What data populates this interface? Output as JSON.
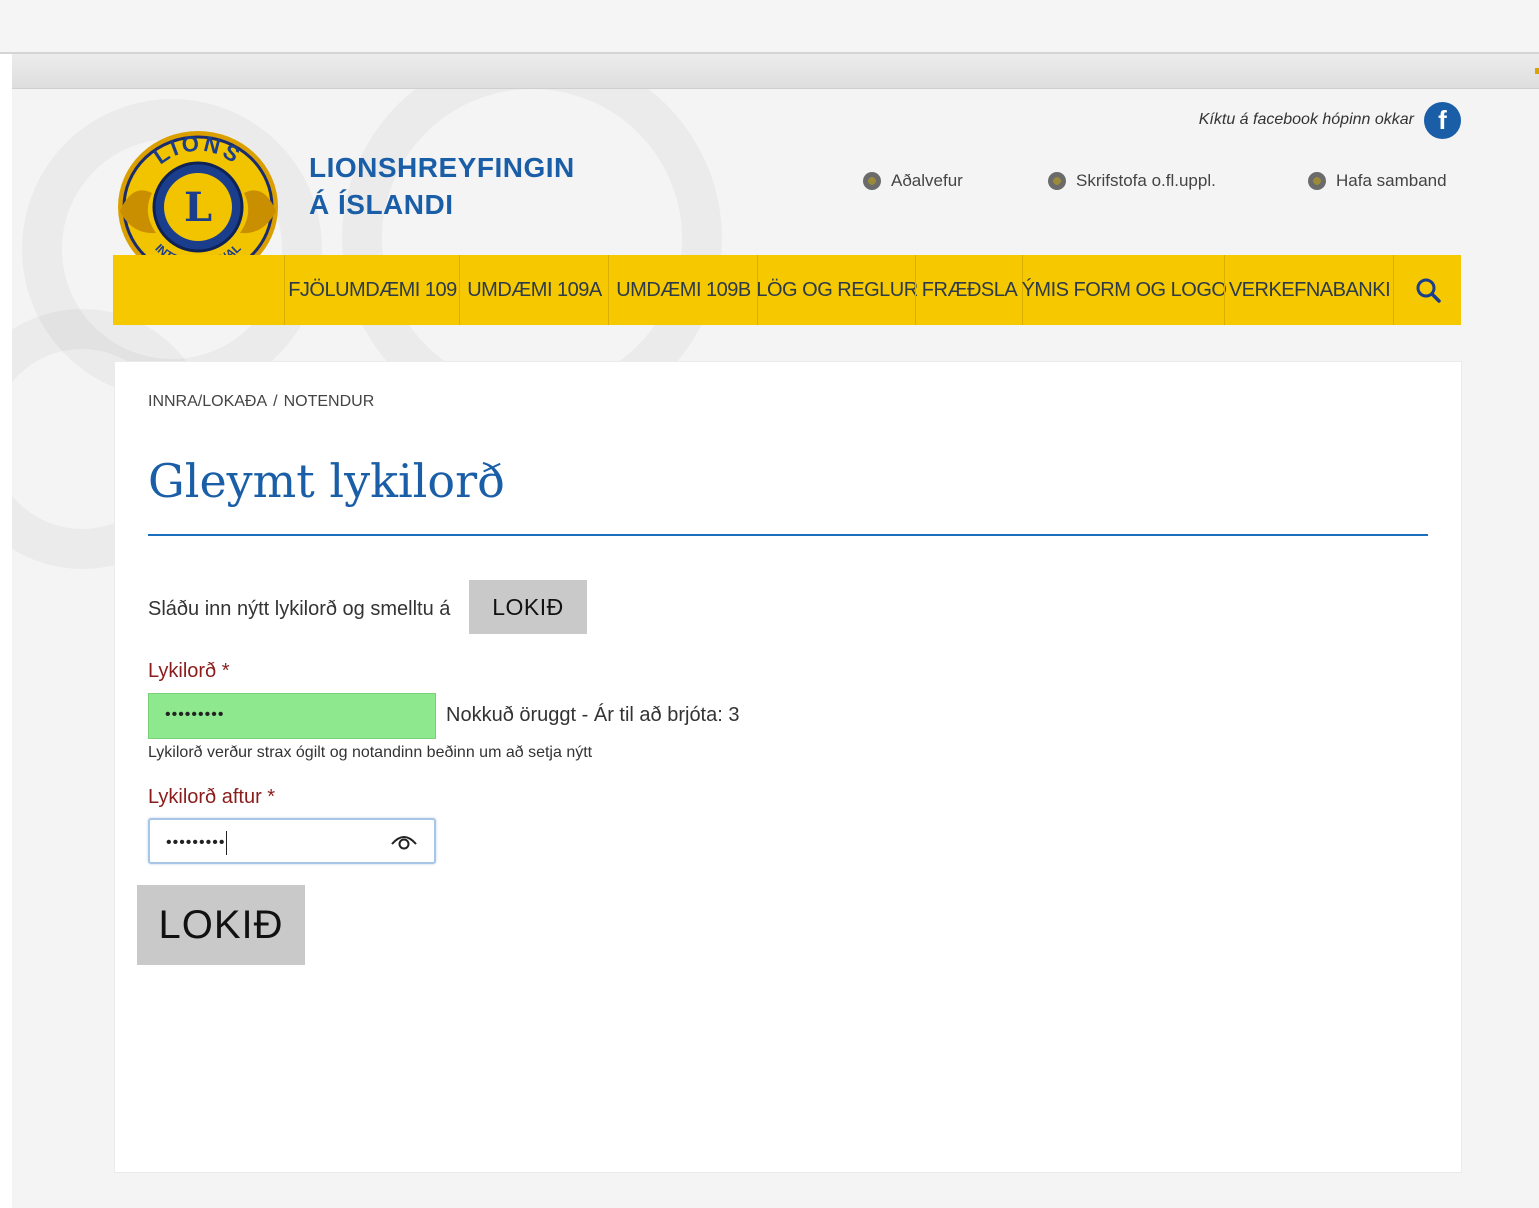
{
  "header": {
    "brand_line1": "LIONSHREYFINGIN",
    "brand_line2": "Á ÍSLANDI",
    "facebook_text": "Kíktu á facebook hópinn okkar",
    "logo_text_top": "LIONS",
    "logo_text_bottom": "INTERNATIONAL",
    "logo_letter": "L",
    "top_links": [
      "Aðalvefur",
      "Skrifstofa o.fl.uppl.",
      "Hafa samband"
    ]
  },
  "nav": {
    "items": [
      "FJÖLUMDÆMI 109",
      "UMDÆMI 109A",
      "UMDÆMI 109B",
      "LÖG OG REGLUR",
      "FRÆÐSLA",
      "ÝMIS FORM OG LOGO",
      "VERKEFNABANKI"
    ]
  },
  "breadcrumb": {
    "items": [
      "INNRA/LOKAÐA",
      "NOTENDUR"
    ],
    "separator": "/"
  },
  "page_title": "Gleymt lykilorð",
  "form": {
    "instruction": "Sláðu inn nýtt lykilorð og smelltu á",
    "inline_button": "LOKIÐ",
    "password_label": "Lykilorð *",
    "password_value": "•••••••••",
    "strength_text": "Nokkuð öruggt - Ár til að brjóta: 3",
    "help_text": "Lykilorð verður strax ógilt og notandinn beðinn um að setja nýtt",
    "confirm_label": "Lykilorð aftur *",
    "confirm_value": "•••••••••",
    "submit_button": "LOKIÐ"
  },
  "colors": {
    "brand_blue": "#1a5ea8",
    "nav_yellow": "#f5c800",
    "strength_green": "#8ee88e",
    "label_red": "#8b1c1c",
    "button_gray": "#c9c9c9"
  }
}
